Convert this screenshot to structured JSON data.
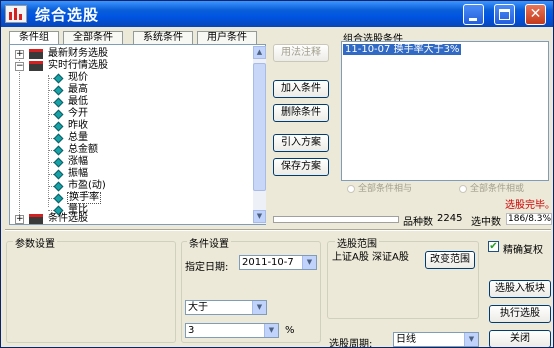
{
  "window": {
    "title": "综合选股",
    "controls": {
      "minimize": "minimize-icon",
      "maximize": "maximize-icon",
      "close": "close-icon"
    }
  },
  "tabs": [
    "条件组",
    "全部条件",
    "系统条件",
    "用户条件"
  ],
  "active_tab": "条件组",
  "tree": {
    "nodes": [
      {
        "label": "最新财务选股",
        "expanded": false
      },
      {
        "label": "实时行情选股",
        "expanded": true,
        "children": [
          "现价",
          "最高",
          "最低",
          "今开",
          "昨收",
          "总量",
          "总金额",
          "涨幅",
          "振幅",
          "市盈(动)",
          "换手率",
          "量比"
        ],
        "selected": "换手率"
      },
      {
        "label": "条件选股",
        "expanded": false
      }
    ]
  },
  "buttons": {
    "formula_help": "用法注释",
    "add_condition": "加入条件",
    "delete_condition": "删除条件",
    "import_plan": "引入方案",
    "save_plan": "保存方案",
    "change_range": "改变范围",
    "stocks_to_block": "选股入板块",
    "run_selection": "执行选股",
    "close": "关闭"
  },
  "combined_conditions": {
    "title": "组合选股条件",
    "items": [
      "11-10-07  换手率大于3%"
    ]
  },
  "logic": {
    "and_label": "全部条件相与",
    "or_label": "全部条件相或"
  },
  "status": {
    "message": "选股完毕。",
    "message_color": "#cc0000",
    "total_label": "品种数",
    "total_value": "2245",
    "selected_label": "选中数",
    "selected_value": "186/8.3%"
  },
  "params": {
    "title": "参数设置"
  },
  "condition_settings": {
    "title": "条件设置",
    "date_label": "指定日期:",
    "date_value": "2011-10-7",
    "operator": "大于",
    "value": "3",
    "unit": "%"
  },
  "stock_range": {
    "title": "选股范围",
    "items": "上证A股  深证A股"
  },
  "precise_rights": {
    "label": "精确复权",
    "checked": true
  },
  "period": {
    "label": "选股周期:",
    "value": "日线"
  }
}
